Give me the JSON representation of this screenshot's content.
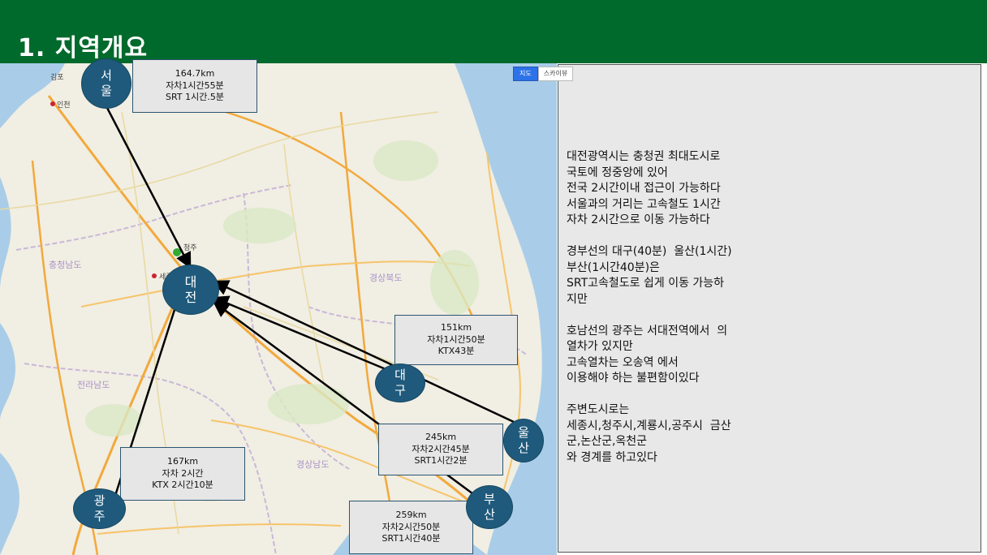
{
  "title": "1. 지역개요",
  "map": {
    "tab_map": "지도",
    "tab_sky": "스카이뷰",
    "labels": [
      "김포",
      "인천",
      "충청남도",
      "경상북도",
      "전라남도",
      "경상남도",
      "청주",
      "세종"
    ]
  },
  "cities": {
    "seoul": [
      "서",
      "울"
    ],
    "daejeon": [
      "대",
      "전"
    ],
    "daegu": [
      "대",
      "구"
    ],
    "ulsan": [
      "울",
      "산"
    ],
    "busan": [
      "부",
      "산"
    ],
    "gwangju": [
      "광",
      "주"
    ]
  },
  "distances": {
    "seoul": [
      "164.7km",
      "자차1시간55분",
      "SRT 1시간.5분"
    ],
    "daegu": [
      "151km",
      "자차1시간50분",
      "KTX43분"
    ],
    "ulsan": [
      "245km",
      "자차2시간45분",
      "SRT1시간2분"
    ],
    "busan": [
      "259km",
      "자차2시간50분",
      "SRT1시간40분"
    ],
    "gwangju": [
      "167km",
      "자차 2시간",
      "KTX 2시간10분"
    ]
  },
  "info_lines": [
    "대전광역시는 충청권 최대도시로",
    "국토에 정중앙에 있어",
    "전국 2시간이내 접근이 가능하다",
    "서울과의 거리는 고속철도 1시간",
    "자차 2시간으로 이동 가능하다",
    "",
    "경부선의 대구(40분)  울산(1시간)",
    "부산(1시간40분)은",
    "SRT고속철도로 쉽게 이동 가능하",
    "지만",
    "",
    "호남선의 광주는 서대전역에서  의",
    "열차가 있지만",
    "고속열차는 오송역 에서",
    "이용해야 하는 불편함이있다",
    "",
    "주변도시로는",
    "세종시,청주시,계룡시,공주시  금산",
    "군,논산군,옥천군",
    "와 경계를 하고있다"
  ],
  "colors": {
    "header": "#006a2c",
    "city_circle": "#1f5a7c",
    "sea": "#a9cde8",
    "land": "#f1eee3"
  }
}
